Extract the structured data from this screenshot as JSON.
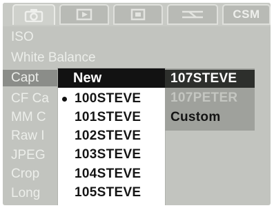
{
  "tabs": [
    {
      "name": "tab-shooting",
      "icon": "camera-icon",
      "label": ""
    },
    {
      "name": "tab-playback",
      "icon": "playback-icon",
      "label": ""
    },
    {
      "name": "tab-setup-2",
      "icon": "setup-icon",
      "label": ""
    },
    {
      "name": "tab-function",
      "icon": "function-icon",
      "label": ""
    },
    {
      "name": "tab-csm",
      "icon": "",
      "label": "CSM"
    }
  ],
  "menu": {
    "items": [
      "ISO",
      "White Balance",
      "Capt",
      "CF Ca",
      "MM C",
      "Raw I",
      "JPEG",
      "Crop",
      "Long"
    ]
  },
  "popup": {
    "new_label": "New",
    "selected_folder": "100STEVE",
    "folders": [
      "100STEVE",
      "101STEVE",
      "102STEVE",
      "103STEVE",
      "104STEVE",
      "105STEVE"
    ]
  },
  "right_panel": {
    "items": [
      {
        "label": "107STEVE",
        "state": "selected"
      },
      {
        "label": "107PETER",
        "state": "disabled"
      },
      {
        "label": "Custom",
        "state": "normal"
      }
    ]
  },
  "colors": {
    "lcd_background": "#c2c4bf",
    "highlight_bar": "#121212",
    "popup_background": "#ffffff"
  }
}
